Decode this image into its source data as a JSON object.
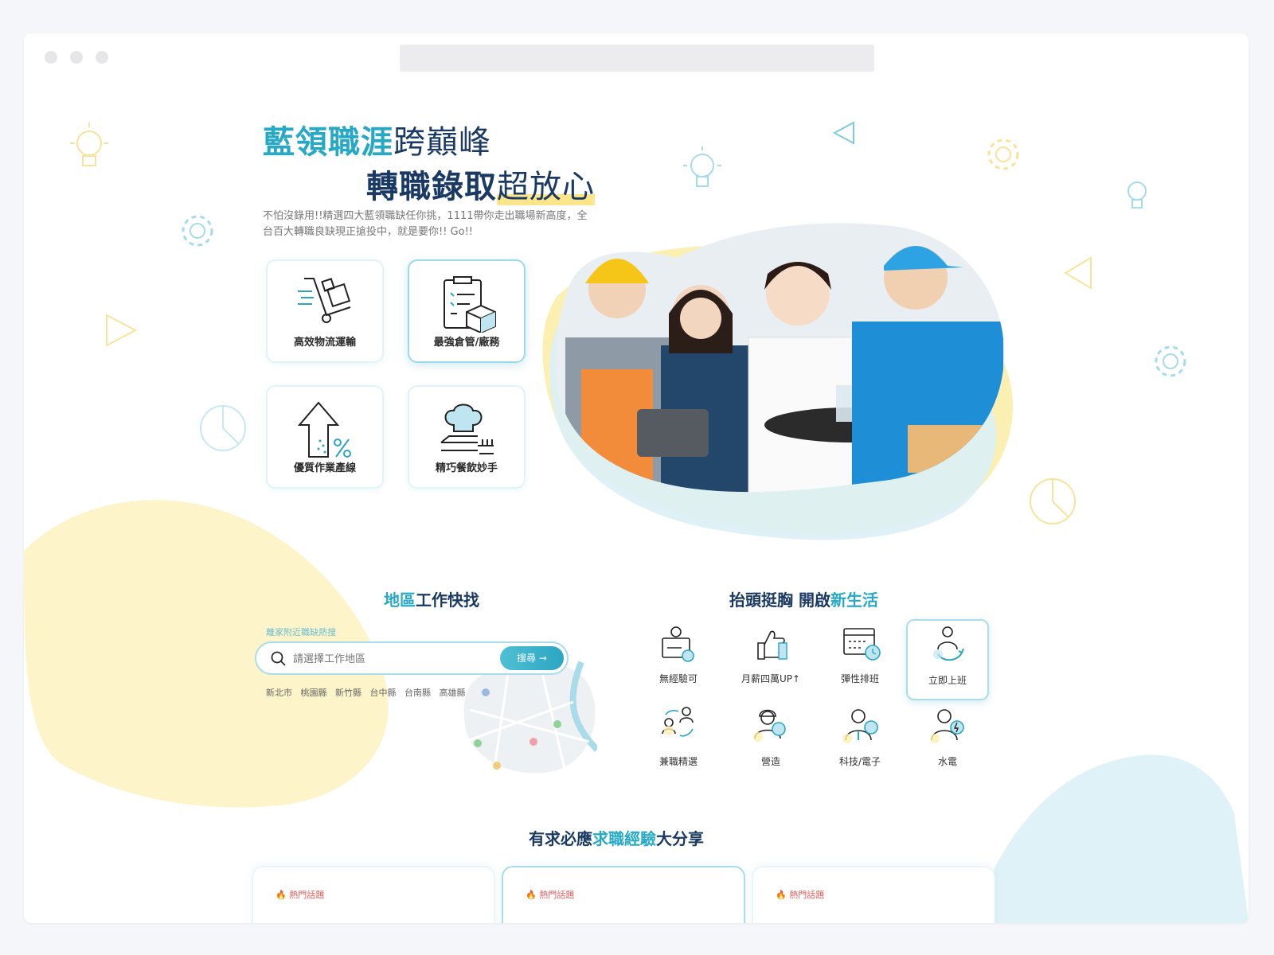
{
  "hero": {
    "title1_grad": "藍領職涯",
    "title1_rest": "跨巔峰",
    "title2_bold": "轉職錄取",
    "title2_rest": "超放心",
    "desc": "不怕沒錄用!!精選四大藍領職缺任你挑，1111帶你走出職場新高度，全台百大轉職良缺現正搶投中，就是要你!! Go!!"
  },
  "categories": [
    {
      "label": "高效物流運輸",
      "icon": "hand-truck-icon"
    },
    {
      "label": "最強倉管/廠務",
      "icon": "clipboard-box-icon"
    },
    {
      "label": "優質作業產線",
      "icon": "growth-arrow-icon"
    },
    {
      "label": "精巧餐飲妙手",
      "icon": "chef-hat-icon"
    }
  ],
  "region": {
    "title_hl": "地區",
    "title_rest": "工作快找",
    "label": "離家附近職缺熱搜",
    "placeholder": "請選擇工作地區",
    "button": "搜尋 →",
    "cities": [
      "新北市",
      "桃園縣",
      "新竹縣",
      "台中縣",
      "台南縣",
      "高雄縣"
    ]
  },
  "benefits": {
    "title_dark": "抬頭挺胸 開啟",
    "title_hl": "新生活",
    "items": [
      {
        "label": "無經驗可",
        "icon": "certificate-person-icon"
      },
      {
        "label": "月薪四萬UP↑",
        "icon": "thumbs-up-icon"
      },
      {
        "label": "彈性排班",
        "icon": "calendar-clock-icon"
      },
      {
        "label": "立即上班",
        "icon": "person-refresh-icon"
      },
      {
        "label": "兼職精選",
        "icon": "people-exchange-icon"
      },
      {
        "label": "營造",
        "icon": "worker-helmet-icon"
      },
      {
        "label": "科技/電子",
        "icon": "tech-person-icon"
      },
      {
        "label": "水電",
        "icon": "electrician-icon"
      }
    ]
  },
  "experience": {
    "title_dark1": "有求必應",
    "title_hl": "求職經驗",
    "title_dark2": "大分享",
    "cards": [
      {
        "tag": "熱門話題"
      },
      {
        "tag": "熱門話題"
      },
      {
        "tag": "熱門話題"
      }
    ]
  },
  "colors": {
    "accent": "#27a9c6",
    "navy": "#1a3963",
    "yellow": "#fdf0b0",
    "blue": "#dff2f8"
  }
}
